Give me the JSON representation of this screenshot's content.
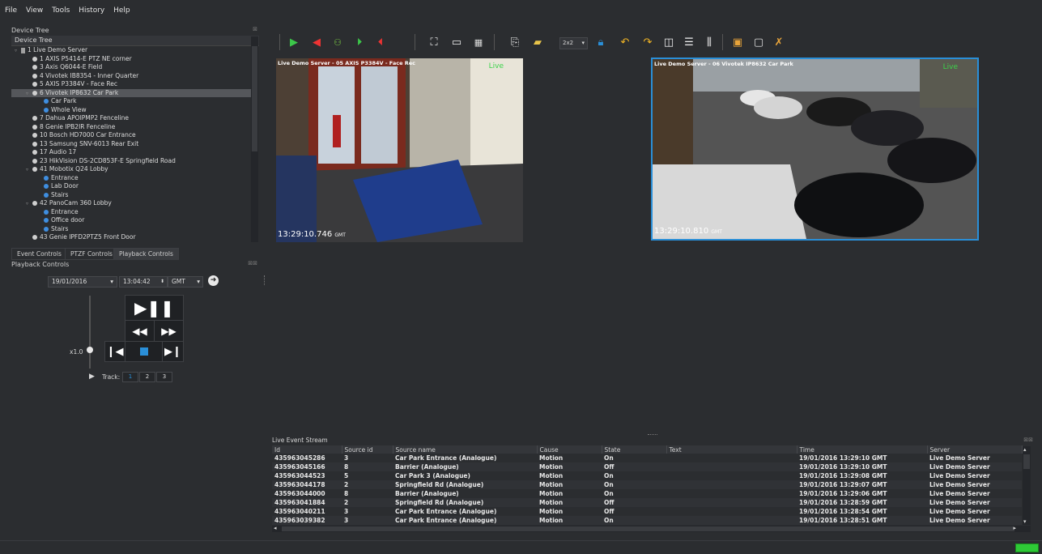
{
  "menu": {
    "file": "File",
    "view": "View",
    "tools": "Tools",
    "history": "History",
    "help": "Help"
  },
  "device_tree": {
    "panel_title": "Device Tree",
    "selector_value": "Device Tree",
    "items": [
      {
        "label": "1 Live Demo Server",
        "level": 0,
        "icon": "server-icon"
      },
      {
        "label": "1 AXIS P5414-E PTZ NE corner",
        "level": 1,
        "icon": "camera-icon"
      },
      {
        "label": "3 Axis Q6044-E Field",
        "level": 1,
        "icon": "camera-icon"
      },
      {
        "label": "4 Vivotek IB8354 - Inner Quarter",
        "level": 1,
        "icon": "camera-icon"
      },
      {
        "label": "5 AXIS P3384V - Face Rec",
        "level": 1,
        "icon": "camera-icon"
      },
      {
        "label": "6 Vivotek IP8632 Car Park",
        "level": 1,
        "icon": "camera-icon",
        "selected": true
      },
      {
        "label": "Car Park",
        "level": 2,
        "icon": "view-icon"
      },
      {
        "label": "Whole View",
        "level": 2,
        "icon": "view-icon"
      },
      {
        "label": "7 Dahua APOIPMP2 Fenceline",
        "level": 1,
        "icon": "camera-icon"
      },
      {
        "label": "8 Genie IPB2IR Fenceline",
        "level": 1,
        "icon": "camera-icon"
      },
      {
        "label": "10 Bosch HD7000 Car Entrance",
        "level": 1,
        "icon": "camera-icon"
      },
      {
        "label": "13 Samsung SNV-6013 Rear Exit",
        "level": 1,
        "icon": "camera-icon"
      },
      {
        "label": "17 Audio 17",
        "level": 1,
        "icon": "microphone-icon"
      },
      {
        "label": "23 HikVision DS-2CD853F-E Springfield Road",
        "level": 1,
        "icon": "camera-icon"
      },
      {
        "label": "41 Mobotix Q24 Lobby",
        "level": 1,
        "icon": "camera-icon"
      },
      {
        "label": "Entrance",
        "level": 2,
        "icon": "view-icon"
      },
      {
        "label": "Lab Door",
        "level": 2,
        "icon": "view-icon"
      },
      {
        "label": "Stairs",
        "level": 2,
        "icon": "view-icon"
      },
      {
        "label": "42 PanoCam 360 Lobby",
        "level": 1,
        "icon": "camera-icon"
      },
      {
        "label": "Entrance",
        "level": 2,
        "icon": "view-icon"
      },
      {
        "label": "Office door",
        "level": 2,
        "icon": "view-icon"
      },
      {
        "label": "Stairs",
        "level": 2,
        "icon": "view-icon"
      },
      {
        "label": "43 Genie IPFD2PTZ5 Front Door",
        "level": 1,
        "icon": "camera-icon"
      }
    ]
  },
  "tabs": {
    "event_controls": "Event Controls",
    "ptzf_controls": "PTZF Controls",
    "playback_controls": "Playback Controls"
  },
  "playback": {
    "panel_title": "Playback Controls",
    "date": "19/01/2016",
    "time": "13:04:42",
    "timezone": "GMT",
    "speed": "x1.0",
    "track_label": "Track:",
    "tracks": [
      "1",
      "2",
      "3"
    ]
  },
  "toolbar": {
    "layout_value": "2x2",
    "icons": [
      "play-icon",
      "bookmark-red-icon",
      "network-icon",
      "go-start-icon",
      "go-end-icon",
      "fullscreen-icon",
      "monitor-icon",
      "grid-icon",
      "export-icon",
      "clapperboard-icon",
      "layout-select",
      "lock-icon",
      "undo-icon",
      "redo-icon",
      "screen-icon",
      "settings-icon",
      "mixer-icon",
      "display-icon",
      "blank-display-icon",
      "mic-off-icon"
    ]
  },
  "videos": [
    {
      "header": "Live Demo Server - 05 AXIS P3384V - Face Rec",
      "live": "Live",
      "timestamp": "13:29:10.746",
      "tz": "GMT"
    },
    {
      "header": "Live Demo Server - 06 Vivotek IP8632 Car Park",
      "live": "Live",
      "timestamp": "13:29:10.810",
      "tz": "GMT"
    }
  ],
  "event_stream": {
    "title": "Live Event Stream",
    "columns": [
      "Id",
      "Source id",
      "Source name",
      "Cause",
      "State",
      "Text",
      "Time",
      "Server"
    ],
    "rows": [
      [
        "435963045286",
        "3",
        "Car Park Entrance (Analogue)",
        "Motion",
        "On",
        "",
        "19/01/2016 13:29:10 GMT",
        "Live Demo Server"
      ],
      [
        "435963045166",
        "8",
        "Barrier (Analogue)",
        "Motion",
        "Off",
        "",
        "19/01/2016 13:29:10 GMT",
        "Live Demo Server"
      ],
      [
        "435963044523",
        "5",
        "Car Park 3 (Analogue)",
        "Motion",
        "On",
        "",
        "19/01/2016 13:29:08 GMT",
        "Live Demo Server"
      ],
      [
        "435963044178",
        "2",
        "Springfield Rd (Analogue)",
        "Motion",
        "On",
        "",
        "19/01/2016 13:29:07 GMT",
        "Live Demo Server"
      ],
      [
        "435963044000",
        "8",
        "Barrier (Analogue)",
        "Motion",
        "On",
        "",
        "19/01/2016 13:29:06 GMT",
        "Live Demo Server"
      ],
      [
        "435963041884",
        "2",
        "Springfield Rd (Analogue)",
        "Motion",
        "Off",
        "",
        "19/01/2016 13:28:59 GMT",
        "Live Demo Server"
      ],
      [
        "435963040211",
        "3",
        "Car Park Entrance (Analogue)",
        "Motion",
        "Off",
        "",
        "19/01/2016 13:28:54 GMT",
        "Live Demo Server"
      ],
      [
        "435963039382",
        "3",
        "Car Park Entrance (Analogue)",
        "Motion",
        "On",
        "",
        "19/01/2016 13:28:51 GMT",
        "Live Demo Server"
      ]
    ]
  },
  "colors": {
    "background": "#2b2d30",
    "accent_blue": "#2a8fd8",
    "live_green": "#3bd34a",
    "status_green": "#2ec936"
  }
}
